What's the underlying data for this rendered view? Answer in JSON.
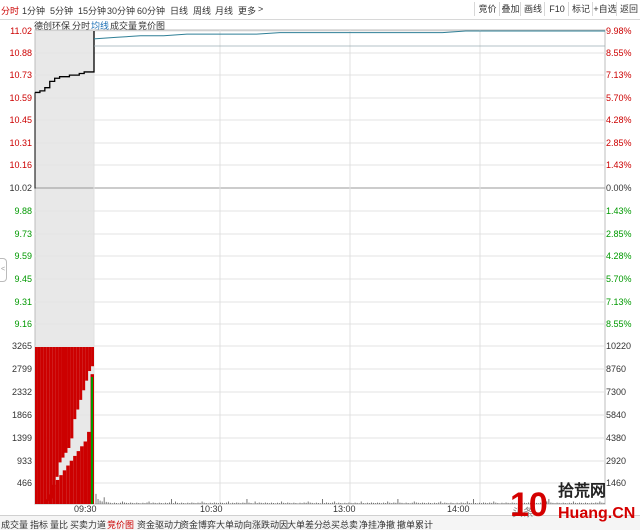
{
  "toolbar": {
    "tabs": [
      {
        "label": "分时",
        "active": true
      },
      {
        "label": "1分钟"
      },
      {
        "label": "5分钟"
      },
      {
        "label": "15分钟"
      },
      {
        "label": "30分钟"
      },
      {
        "label": "60分钟"
      },
      {
        "label": "日线"
      },
      {
        "label": "周线"
      },
      {
        "label": "月线"
      },
      {
        "label": "更多"
      }
    ],
    "more_arrow": ">",
    "right_buttons": [
      "竞价",
      "叠加",
      "画线",
      "F10",
      "标记",
      "+自选",
      "返回"
    ]
  },
  "legend": {
    "stock_name": "德创环保",
    "item1": "分时",
    "item2": "均线",
    "item3": "成交量",
    "item4": "竞价图"
  },
  "price_axis": {
    "left": [
      "11.02",
      "10.88",
      "10.73",
      "10.59",
      "10.45",
      "10.31",
      "10.16",
      "10.02",
      "9.88",
      "9.73",
      "9.59",
      "9.45",
      "9.31",
      "9.16"
    ],
    "right": [
      "9.98%",
      "8.55%",
      "7.13%",
      "5.70%",
      "4.28%",
      "2.85%",
      "1.43%",
      "0.00%",
      "1.43%",
      "2.85%",
      "4.28%",
      "5.70%",
      "7.13%",
      "8.55%"
    ]
  },
  "volume_axis": {
    "left": [
      "3265",
      "2799",
      "2332",
      "1866",
      "1399",
      "933",
      "466"
    ],
    "right": [
      "10220",
      "8760",
      "7300",
      "5840",
      "4380",
      "2920",
      "1460"
    ]
  },
  "time_axis": [
    "09:30",
    "10:30",
    "13:00",
    "14:00"
  ],
  "bottom_tabs": [
    "成交量",
    "指标",
    "量比",
    "买卖力道",
    "竞价图",
    "资金驱动力",
    "资金博弈",
    "大单动向",
    "涨跌动因",
    "大单差分",
    "总买总卖",
    "净挂净撤",
    "撤单累计"
  ],
  "bottom_active_index": 4,
  "side_handle": "<",
  "watermark": {
    "text1": "头条",
    "brand": "拾荒网",
    "url": "Huang.CN",
    "digits": "10"
  },
  "colors": {
    "up": "#cc0000",
    "down": "#009900",
    "price_line": "#2f7f96",
    "avg_line": "#222222",
    "auction_bg": "#e8e8e8"
  },
  "chart_data": {
    "type": "line",
    "price_range": [
      9.16,
      11.02
    ],
    "prev_close": 10.02,
    "auction_price_series": [
      10.63,
      10.64,
      10.66,
      10.7,
      10.72,
      10.73,
      10.73,
      10.74,
      10.74,
      10.75,
      10.76,
      10.76,
      11.02
    ],
    "intraday_price_series": [
      10.97,
      10.98,
      10.99,
      10.99,
      11.0,
      11.0,
      11.0,
      11.0,
      11.01,
      11.01,
      11.01,
      11.01,
      11.01,
      11.01,
      11.01,
      11.01,
      11.02,
      11.02,
      11.02,
      11.02,
      11.02,
      11.02,
      11.02
    ],
    "auction_buy_volume": [
      3265,
      3265,
      3265,
      3265,
      3200,
      3150,
      2900,
      2700,
      2400,
      2300,
      2200,
      2100,
      1900,
      1500,
      1300,
      1100,
      900,
      700,
      500,
      400
    ],
    "auction_sell_volume": [
      0,
      0,
      0,
      100,
      200,
      400,
      500,
      600,
      700,
      800,
      900,
      1000,
      1100,
      1200,
      1300,
      1500,
      2700
    ],
    "intraday_volume_max": 933
  }
}
